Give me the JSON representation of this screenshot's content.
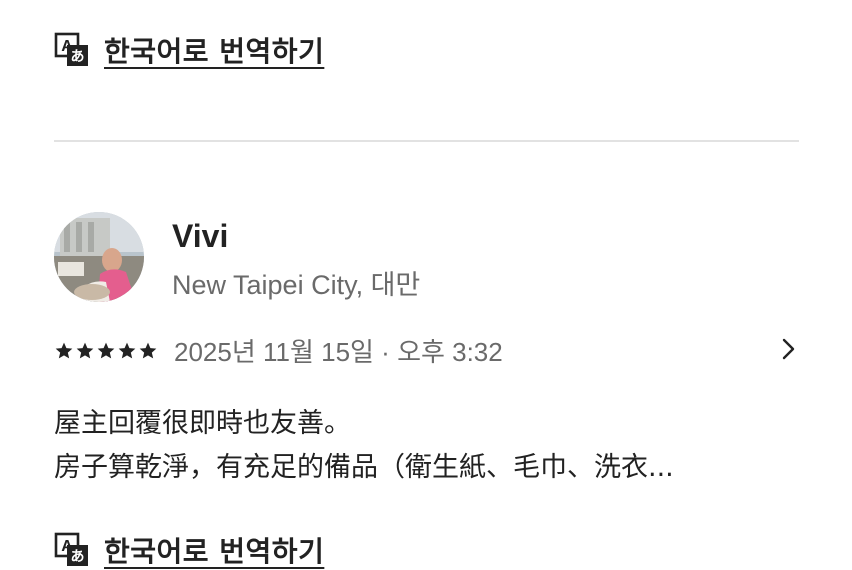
{
  "translate_link": {
    "label": "한국어로 번역하기",
    "icon": "translate-icon"
  },
  "review": {
    "reviewer": {
      "name": "Vivi",
      "location": "New Taipei City, 대만",
      "avatar": "avatar-photo"
    },
    "rating": 5,
    "date": "2025년 11월 15일 · 오후 3:32",
    "body_lines": [
      "屋主回覆很即時也友善。",
      "房子算乾淨，有充足的備品（衛生紙、毛巾、洗衣..."
    ]
  },
  "colors": {
    "text_primary": "#222222",
    "text_secondary": "#6a6a6a",
    "divider": "#e2e2e2"
  }
}
